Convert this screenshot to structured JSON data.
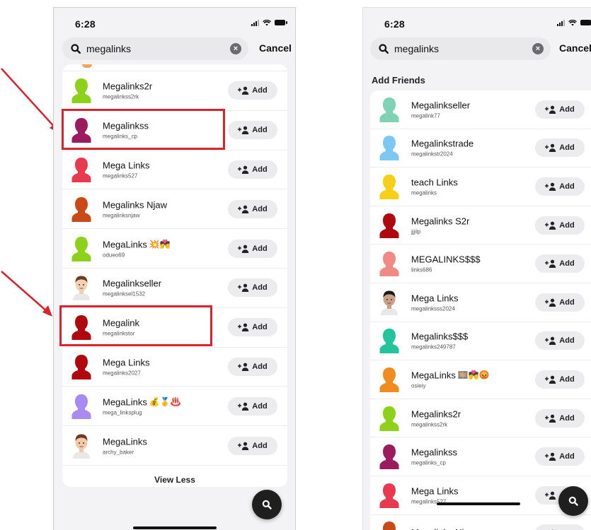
{
  "colors": {
    "accent_red": "#d9232e",
    "fab": "#1f1f1f",
    "card_bg": "#ffffff",
    "app_bg": "#f3f3f5"
  },
  "left_screen": {
    "status_time": "6:28",
    "search_query": "megalinks",
    "cancel_label": "Cancel",
    "add_label": "Add",
    "view_less_label": "View Less",
    "results": [
      {
        "name": "Megalinks2r",
        "username": "megalinkss2rk",
        "avatar_color": "#8ed11b",
        "avatar_type": "silhouette",
        "highlighted": false
      },
      {
        "name": "Megalinkss",
        "username": "megalinks_cp",
        "avatar_color": "#9c1a5e",
        "avatar_type": "silhouette",
        "highlighted": true
      },
      {
        "name": "Mega Links",
        "username": "megalinks527",
        "avatar_color": "#e83a4f",
        "avatar_type": "silhouette",
        "highlighted": false
      },
      {
        "name": "Megalinks Njaw",
        "username": "megalinksnjaw",
        "avatar_color": "#c94a16",
        "avatar_type": "silhouette",
        "highlighted": false
      },
      {
        "name": "MegaLinks",
        "emoji": "💥💏",
        "username": "odueo69",
        "avatar_color": "#8ed11b",
        "avatar_type": "silhouette",
        "highlighted": false
      },
      {
        "name": "Megalinkseller",
        "username": "megalinksel1532",
        "avatar_color": "#f2d0b4",
        "avatar_type": "bitmoji",
        "highlighted": false
      },
      {
        "name": "Megalink",
        "username": "megalinkstor",
        "avatar_color": "#b0080f",
        "avatar_type": "silhouette",
        "highlighted": true
      },
      {
        "name": "Mega Links",
        "username": "megalinks2027",
        "avatar_color": "#b0080f",
        "avatar_type": "silhouette",
        "highlighted": false
      },
      {
        "name": "MegaLinks",
        "emoji": "💰🥇♨️",
        "username": "mega_linksplug",
        "avatar_color": "#a98af2",
        "avatar_type": "silhouette",
        "highlighted": false
      },
      {
        "name": "MegaLinks",
        "username": "archy_baker",
        "avatar_color": "#f2c9a8",
        "avatar_type": "bitmoji",
        "highlighted": false
      }
    ]
  },
  "right_screen": {
    "status_time": "6:28",
    "search_query": "megalinks",
    "cancel_label": "Cancel",
    "section_title": "Add Friends",
    "add_label": "Add",
    "results": [
      {
        "name": "Megalinkseller",
        "username": "megalink77",
        "avatar_color": "#7dd3b4",
        "avatar_type": "silhouette"
      },
      {
        "name": "Megalinkstrade",
        "username": "megalinkstr2024",
        "avatar_color": "#7cc8f4",
        "avatar_type": "silhouette"
      },
      {
        "name": "teach Links",
        "username": "megalinks",
        "avatar_color": "#f7cf18",
        "avatar_type": "silhouette"
      },
      {
        "name": "Megalinks S2r",
        "username": "jjjilp",
        "avatar_color": "#b0080f",
        "avatar_type": "silhouette"
      },
      {
        "name": "MEGALINKS$$$",
        "username": "links686",
        "avatar_color": "#f08a84",
        "avatar_type": "silhouette"
      },
      {
        "name": "Mega Links",
        "username": "megalinksss2024",
        "avatar_color": "#3a3a3a",
        "avatar_type": "bitmoji"
      },
      {
        "name": "Megalinks$$$",
        "username": "megalinks249787",
        "avatar_color": "#22c49c",
        "avatar_type": "silhouette"
      },
      {
        "name": "MegaLinks",
        "emoji": "🎞️💏😡",
        "username": "osieiy",
        "avatar_color": "#f28c1e",
        "avatar_type": "silhouette"
      },
      {
        "name": "Megalinks2r",
        "username": "megalinkss2rk",
        "avatar_color": "#8ed11b",
        "avatar_type": "silhouette"
      },
      {
        "name": "Megalinkss",
        "username": "megalinks_cp",
        "avatar_color": "#9c1a5e",
        "avatar_type": "silhouette"
      },
      {
        "name": "Mega Links",
        "username": "megalinks527",
        "avatar_color": "#e83a4f",
        "avatar_type": "silhouette"
      },
      {
        "name": "Megalinks Njaw",
        "username": "",
        "avatar_color": "#c94a16",
        "avatar_type": "silhouette"
      }
    ]
  },
  "icons": {
    "search": "search-icon",
    "clear": "clear-icon",
    "add_friend": "add-friend-icon",
    "fab": "search-fab-icon",
    "signal": "signal-icon",
    "wifi": "wifi-icon",
    "battery": "battery-icon"
  }
}
